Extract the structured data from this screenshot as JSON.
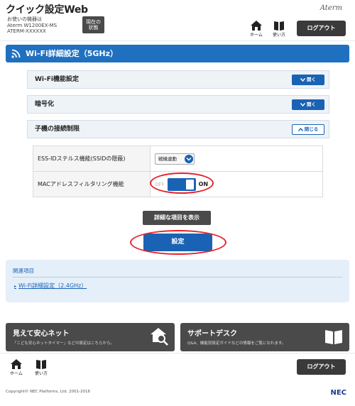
{
  "header": {
    "app_title": "クイック設定Web",
    "device_label": "お使いの機器は",
    "device_model": "Aterm W1200EX-MS",
    "device_id": "ATERM-XXXXXX",
    "status_button": "現在の\n状態",
    "brand": "Aterm",
    "home_label": "ホーム",
    "help_label": "使い方",
    "logout_label": "ログアウト"
  },
  "section": {
    "title": "Wi-Fi詳細設定（5GHz）"
  },
  "accordions": [
    {
      "label": "Wi-Fi機能設定",
      "button": "開く",
      "state": "collapsed"
    },
    {
      "label": "暗号化",
      "button": "開く",
      "state": "collapsed"
    },
    {
      "label": "子機の接続制限",
      "button": "閉じる",
      "state": "expanded"
    }
  ],
  "settings": [
    {
      "label": "ESS-IDステルス機能(SSIDの隠蔽)",
      "value": "戦機連動"
    },
    {
      "label": "MACアドレスフィルタリング機能",
      "off_label": "OFF",
      "on_label": "ON",
      "toggle_on": true
    }
  ],
  "buttons": {
    "detail": "詳細な項目を表示",
    "submit": "設定"
  },
  "related": {
    "heading": "関連項目",
    "link": "Wi-Fi詳細設定（2.4GHz）"
  },
  "cards": [
    {
      "title": "見えて安心ネット",
      "desc": "「こども安心ネットタイマー」などの設定はこちらから。",
      "icon": "house-search-icon"
    },
    {
      "title": "サポートデスク",
      "desc": "Q&A、機能別設定ガイドなどの情報をご覧になれます。",
      "icon": "book-icon"
    }
  ],
  "footer": {
    "home_label": "ホーム",
    "help_label": "使い方",
    "logout_label": "ログアウト",
    "copyright": "Copyright© NEC Platforms, Ltd. 2001-2016",
    "logo": "NEC"
  },
  "colors": {
    "accent": "#2070c0",
    "highlight": "#e8202a"
  }
}
